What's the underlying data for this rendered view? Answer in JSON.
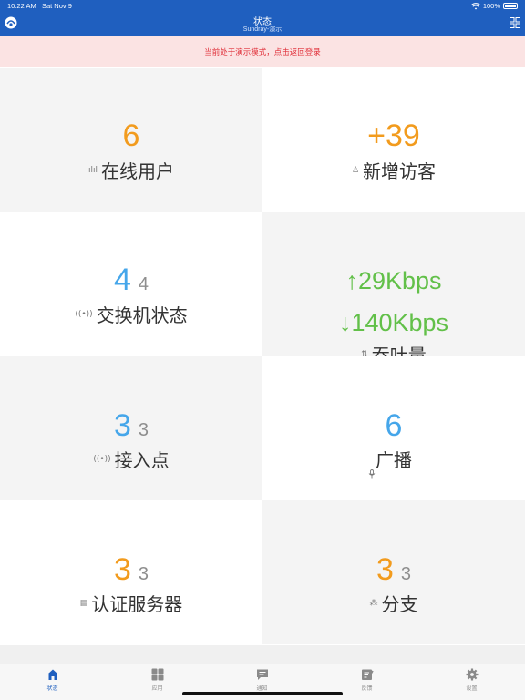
{
  "status_bar": {
    "time": "10:22 AM",
    "date": "Sat Nov 9",
    "battery": "100%"
  },
  "nav": {
    "title": "状态",
    "subtitle": "Sundray-演示"
  },
  "banner": {
    "text": "当前处于演示模式，点击返回登录"
  },
  "tiles": {
    "online_users": {
      "value": "6",
      "label": "在线用户"
    },
    "new_visitors": {
      "value": "+39",
      "label": "新增访客"
    },
    "switch_status": {
      "value": "4",
      "total": "4",
      "label": "交换机状态"
    },
    "throughput": {
      "up": "↑29Kbps",
      "down": "↓140Kbps",
      "label": "吞吐量"
    },
    "access_points": {
      "value": "3",
      "total": "3",
      "label": "接入点"
    },
    "broadcast": {
      "value": "6",
      "label": "广播"
    },
    "auth_servers": {
      "value": "3",
      "total": "3",
      "label": "认证服务器"
    },
    "branches": {
      "value": "3",
      "total": "3",
      "label": "分支"
    }
  },
  "tabbar": {
    "items": [
      {
        "label": "状态",
        "icon": "home-icon",
        "active": true
      },
      {
        "label": "应用",
        "icon": "apps-grid-icon",
        "active": false
      },
      {
        "label": "通知",
        "icon": "message-icon",
        "active": false
      },
      {
        "label": "反馈",
        "icon": "feedback-icon",
        "active": false
      },
      {
        "label": "设置",
        "icon": "gear-icon",
        "active": false
      }
    ]
  },
  "colors": {
    "nav_blue": "#1f5fbf",
    "orange": "#f29b1d",
    "blue": "#45a6ea",
    "green": "#62c049",
    "banner_red": "#e0303a"
  }
}
